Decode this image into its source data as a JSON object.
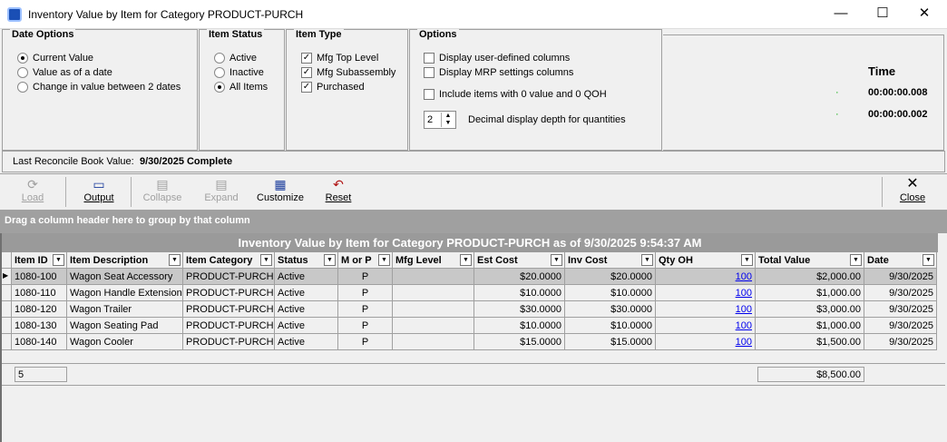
{
  "window": {
    "title": "Inventory Value by Item for Category PRODUCT-PURCH"
  },
  "date_options": {
    "label": "Date Options",
    "items": [
      "Current Value",
      "Value as of a date",
      "Change in value between 2 dates"
    ],
    "selected": 0
  },
  "item_status": {
    "label": "Item Status",
    "items": [
      "Active",
      "Inactive",
      "All Items"
    ],
    "selected": 2
  },
  "item_type": {
    "label": "Item Type",
    "items": [
      {
        "label": "Mfg Top Level",
        "checked": true
      },
      {
        "label": "Mfg Subassembly",
        "checked": true
      },
      {
        "label": "Purchased",
        "checked": true
      }
    ]
  },
  "options": {
    "label": "Options",
    "user_defined": "Display user-defined columns",
    "mrp": "Display MRP settings columns",
    "include_zero": "Include items with 0 value and 0 QOH",
    "decimal_value": "2",
    "decimal_label": "Decimal display depth for quantities"
  },
  "timing": {
    "header": "Time",
    "t1": "00:00:00.008",
    "t2": "00:00:00.002"
  },
  "reconcile": {
    "label": "Last Reconcile Book Value:",
    "value": "9/30/2025 Complete"
  },
  "toolbar": {
    "load": "Load",
    "output": "Output",
    "collapse": "Collapse",
    "expand": "Expand",
    "customize": "Customize",
    "reset": "Reset",
    "close": "Close"
  },
  "group_hint": "Drag a column header here to group by that column",
  "grid": {
    "title": "Inventory Value by Item for Category PRODUCT-PURCH as of 9/30/2025 9:54:37 AM",
    "columns": [
      "Item ID",
      "Item Description",
      "Item Category",
      "Status",
      "M or P",
      "Mfg Level",
      "Est Cost",
      "Inv Cost",
      "Qty OH",
      "Total Value",
      "Date"
    ],
    "rows": [
      [
        "1080-100",
        "Wagon Seat Accessory",
        "PRODUCT-PURCH",
        "Active",
        "P",
        "",
        "$20.0000",
        "$20.0000",
        "100",
        "$2,000.00",
        "9/30/2025"
      ],
      [
        "1080-110",
        "Wagon Handle Extension",
        "PRODUCT-PURCH",
        "Active",
        "P",
        "",
        "$10.0000",
        "$10.0000",
        "100",
        "$1,000.00",
        "9/30/2025"
      ],
      [
        "1080-120",
        "Wagon Trailer",
        "PRODUCT-PURCH",
        "Active",
        "P",
        "",
        "$30.0000",
        "$30.0000",
        "100",
        "$3,000.00",
        "9/30/2025"
      ],
      [
        "1080-130",
        "Wagon Seating Pad",
        "PRODUCT-PURCH",
        "Active",
        "P",
        "",
        "$10.0000",
        "$10.0000",
        "100",
        "$1,000.00",
        "9/30/2025"
      ],
      [
        "1080-140",
        "Wagon Cooler",
        "PRODUCT-PURCH",
        "Active",
        "P",
        "",
        "$15.0000",
        "$15.0000",
        "100",
        "$1,500.00",
        "9/30/2025"
      ]
    ],
    "footer_count": "5",
    "footer_total": "$8,500.00"
  }
}
